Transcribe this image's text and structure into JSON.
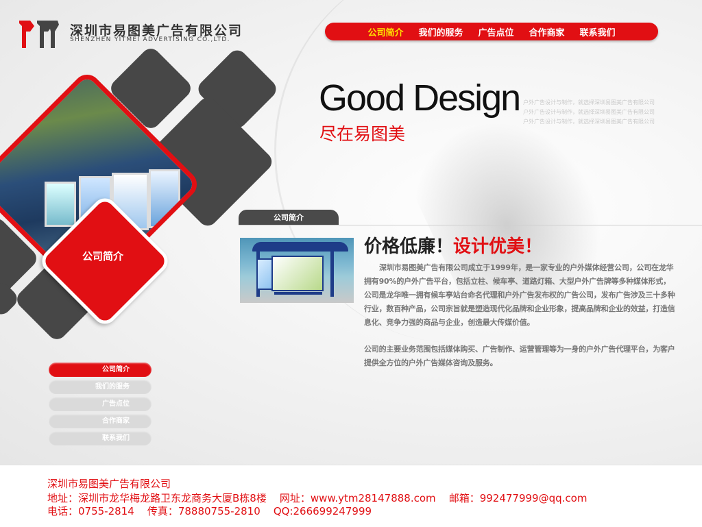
{
  "logo": {
    "cn": "深圳市易图美广告有限公司",
    "en": "SHENZHEN YITMEI ADVERTISING CO.,LTD."
  },
  "topnav": {
    "items": [
      "公司简介",
      "我们的服务",
      "广告点位",
      "合作商家",
      "联系我们"
    ],
    "active_index": 0
  },
  "hero": {
    "headline": "Good Design",
    "subheadline": "尽在易图美",
    "tiny_lines": [
      "户外广告设计与制作，就选择深圳易图美广告有限公司",
      "户外广告设计与制作，就选择深圳易图美广告有限公司",
      "户外广告设计与制作，就选择深圳易图美广告有限公司"
    ]
  },
  "feature": {
    "label": "公司简介"
  },
  "section": {
    "tab": "公司简介"
  },
  "article": {
    "title_part1": "价格低廉！",
    "title_part2": "设计优美！",
    "para1": "深圳市易图美广告有限公司成立于1999年，是一家专业的户外媒体经营公司，公司在龙华拥有90%的户外广告平台，包括立柱、候车亭、道路灯箱、大型户外广告牌等多种媒体形式，公司是龙华唯一拥有候车亭站台命名代理和户外广告发布权的广告公司，发布广告涉及三十多种行业，数百种产品，公司宗旨就是塑造现代化品牌和企业形象，提高品牌和企业的效益，打造信息化、竞争力强的商品与企业，创造最大传媒价值。",
    "para2": "公司的主要业务范围包括媒体购买、广告制作、运营管理等为一身的户外广告代理平台，为客户提供全方位的户外广告媒体咨询及服务。"
  },
  "leftmenu": {
    "items": [
      "公司简介",
      "我们的服务",
      "广告点位",
      "合作商家",
      "联系我们"
    ],
    "active_index": 0
  },
  "footer": {
    "company": "深圳市易图美广告有限公司",
    "line2": "地址：深圳市龙华梅龙路卫东龙商务大厦B栋8楼    网址：www.ytm28147888.com    邮箱：992477999@qq.com",
    "line3": "电话：0755-2814    传真：78880755-2810    QQ:266699247999"
  },
  "colors": {
    "brand_red": "#e10f13",
    "active_nav": "#ffe600",
    "dark_gray": "#474747"
  }
}
